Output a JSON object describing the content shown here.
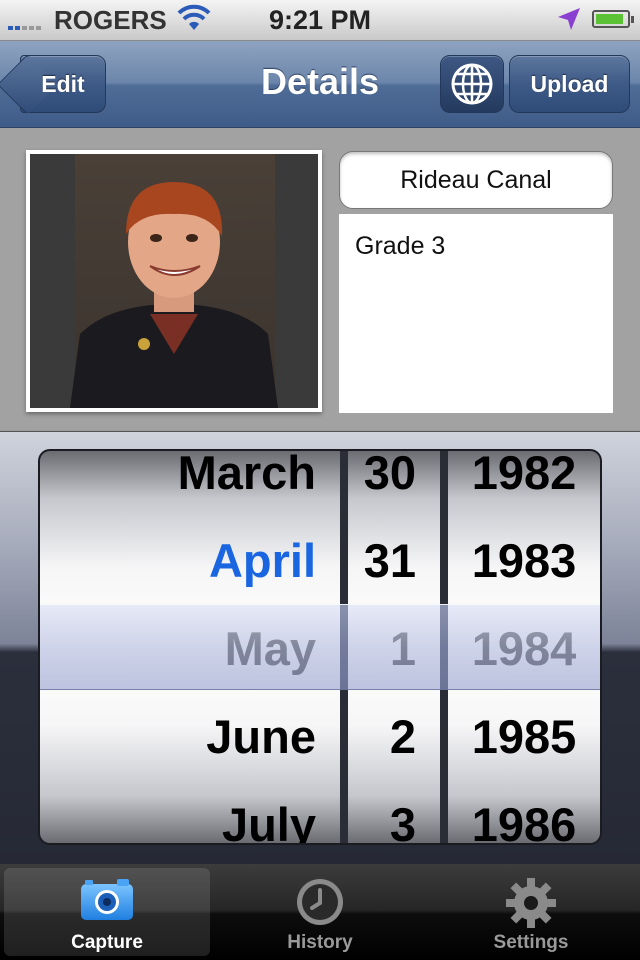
{
  "status_bar": {
    "carrier": "ROGERS",
    "time": "9:21 PM",
    "battery_level": 0.9,
    "icons": [
      "signal-icon",
      "wifi-icon",
      "location-arrow-icon",
      "battery-icon"
    ]
  },
  "navbar": {
    "back_label": "Edit",
    "title": "Details",
    "globe_icon": "globe-icon",
    "upload_label": "Upload"
  },
  "details": {
    "photo_icon": "portrait-photo",
    "title_value": "Rideau Canal",
    "notes_value": "Grade 3"
  },
  "date_picker": {
    "months": [
      "March",
      "April",
      "May",
      "June",
      "July"
    ],
    "days": [
      "30",
      "31",
      "1",
      "2",
      "3"
    ],
    "years": [
      "1982",
      "1983",
      "1984",
      "1985",
      "1986"
    ],
    "selected": {
      "month": "May",
      "day": "1",
      "year": "1984"
    },
    "highlight_color": "#1a66e0"
  },
  "tabbar": {
    "tabs": [
      {
        "label": "Capture",
        "icon": "camera-icon",
        "active": true
      },
      {
        "label": "History",
        "icon": "clock-icon",
        "active": false
      },
      {
        "label": "Settings",
        "icon": "gear-icon",
        "active": false
      }
    ]
  }
}
